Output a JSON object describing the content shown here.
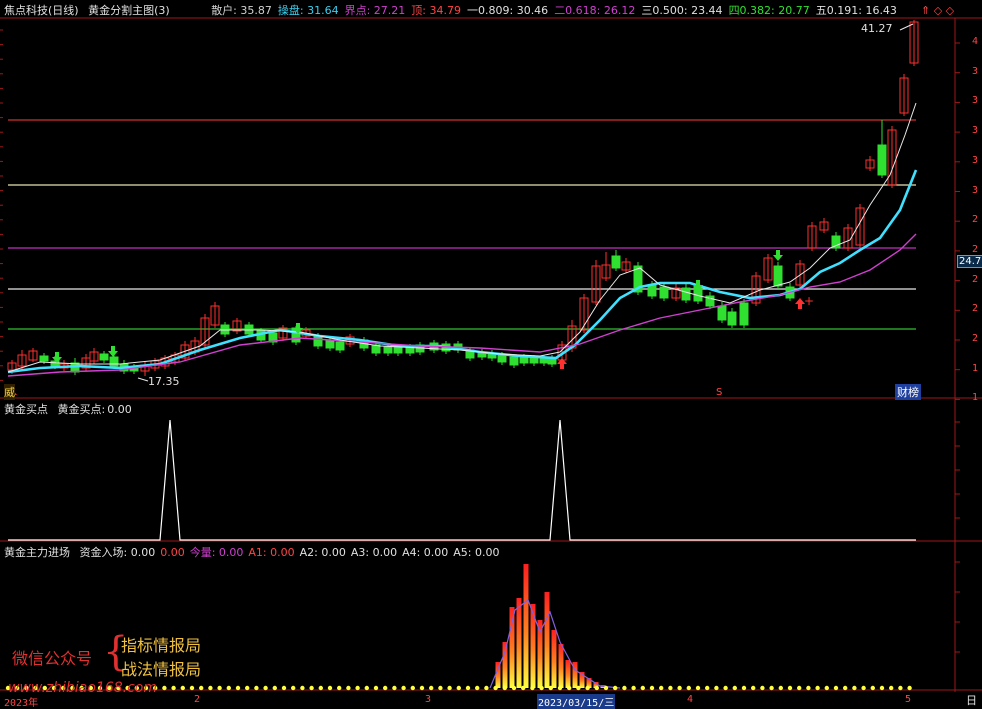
{
  "main": {
    "title": "焦点科技(日线)",
    "indicator": "黄金分割主图(3)",
    "readings": [
      {
        "label": "散户:",
        "value": "35.87",
        "color": "#d0d0d0"
      },
      {
        "label": "操盘:",
        "value": "31.64",
        "color": "#3ad0f0"
      },
      {
        "label": "界点:",
        "value": "27.21",
        "color": "#d040d0"
      },
      {
        "label": "顶:",
        "value": "34.79",
        "color": "#ff4444"
      },
      {
        "label": "一0.809:",
        "value": "30.46",
        "color": "#e0e0e0"
      },
      {
        "label": "二0.618:",
        "value": "26.12",
        "color": "#d040d0"
      },
      {
        "label": "三0.500:",
        "value": "23.44",
        "color": "#e0e0e0"
      },
      {
        "label": "四0.382:",
        "value": "20.77",
        "color": "#30e030"
      },
      {
        "label": "五0.191:",
        "value": "16.43",
        "color": "#e0e0e0"
      }
    ],
    "header_flags": "⇑ ◇ ◇",
    "high_label": "41.27",
    "low_label": "17.35",
    "price_badge": "24.7",
    "left_badge": "威",
    "right_badge": "财榜",
    "s_marker": "S",
    "y_axis_labels": [
      "4",
      "3",
      "3",
      "3",
      "3",
      "3",
      "2",
      "2",
      "2",
      "2",
      "2",
      "1",
      "1"
    ]
  },
  "sub1": {
    "title": "黄金买点",
    "reading_label": "黄金买点:",
    "reading_value": "0.00"
  },
  "sub2": {
    "title": "黄金主力进场",
    "readings": [
      {
        "label": "资金入场:",
        "value": "0.00",
        "color": "#e0e0e0"
      },
      {
        "label": "",
        "value": "0.00",
        "color": "#ff4444"
      },
      {
        "label": "今量:",
        "value": "0.00",
        "color": "#d040d0"
      },
      {
        "label": "A1:",
        "value": "0.00",
        "color": "#ff4444"
      },
      {
        "label": "A2:",
        "value": "0.00",
        "color": "#e0e0e0"
      },
      {
        "label": "A3:",
        "value": "0.00",
        "color": "#e0e0e0"
      },
      {
        "label": "A4:",
        "value": "0.00",
        "color": "#e0e0e0"
      },
      {
        "label": "A5:",
        "value": "0.00",
        "color": "#e0e0e0"
      }
    ],
    "watermark_left": "微信公众号",
    "watermark_right_1": "指标情报局",
    "watermark_right_2": "战法情报局",
    "watermark_url": "www.zhibiao168.com"
  },
  "x_axis": {
    "labels": [
      "2023年",
      "2",
      "3",
      "2023/03/15/三",
      "4",
      "5"
    ],
    "right_button": "日"
  }
}
